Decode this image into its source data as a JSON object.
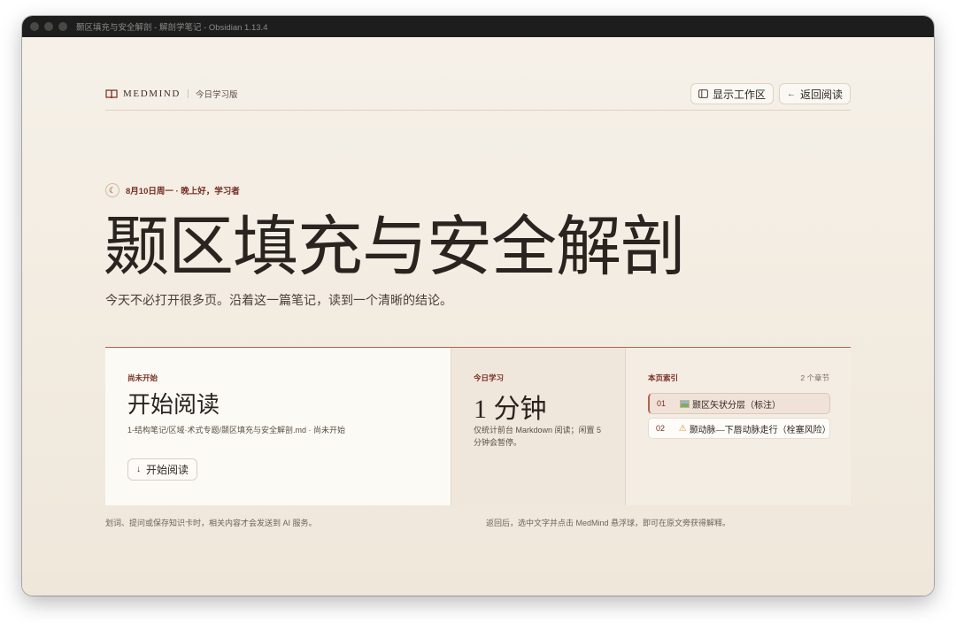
{
  "window": {
    "title": "颞区填充与安全解剖 - 解剖学笔记 - Obsidian 1.13.4"
  },
  "header": {
    "brand_name": "MEDMIND",
    "brand_sub": "今日学习版",
    "show_workspace_label": "显示工作区",
    "back_label": "返回阅读"
  },
  "hero": {
    "date_line": "8月10日周一 · 晚上好，学习者",
    "title": "颞区填充与安全解剖",
    "subtitle": "今天不必打开很多页。沿着这一篇笔记，读到一个清晰的结论。"
  },
  "cards": {
    "status": {
      "kicker": "尚未开始",
      "title": "开始阅读",
      "path": "1-结构笔记/区域·术式专题/颞区填充与安全解剖.md · 尚未开始",
      "button": "开始阅读"
    },
    "today": {
      "kicker": "今日学习",
      "value": "1 分钟",
      "note": "仅统计前台 Markdown 阅读；闲置 5 分钟会暂停。"
    },
    "index": {
      "kicker": "本页索引",
      "count": "2 个章节",
      "items": [
        {
          "num": "01",
          "label": "颞区矢状分层（标注）",
          "icon": "image-icon",
          "active": true
        },
        {
          "num": "02",
          "label": "颞动脉—下唇动脉走行（栓塞风险）",
          "icon": "warning-icon",
          "active": false
        }
      ]
    }
  },
  "footer": {
    "left": "划词、提问或保存知识卡时，相关内容才会发送到 AI 服务。",
    "right": "返回后，选中文字并点击 MedMind 悬浮球，即可在原文旁获得解释。"
  },
  "colors": {
    "accent": "#7a2e1f",
    "accent_line": "#b8614c",
    "background": "#f3ede4"
  }
}
